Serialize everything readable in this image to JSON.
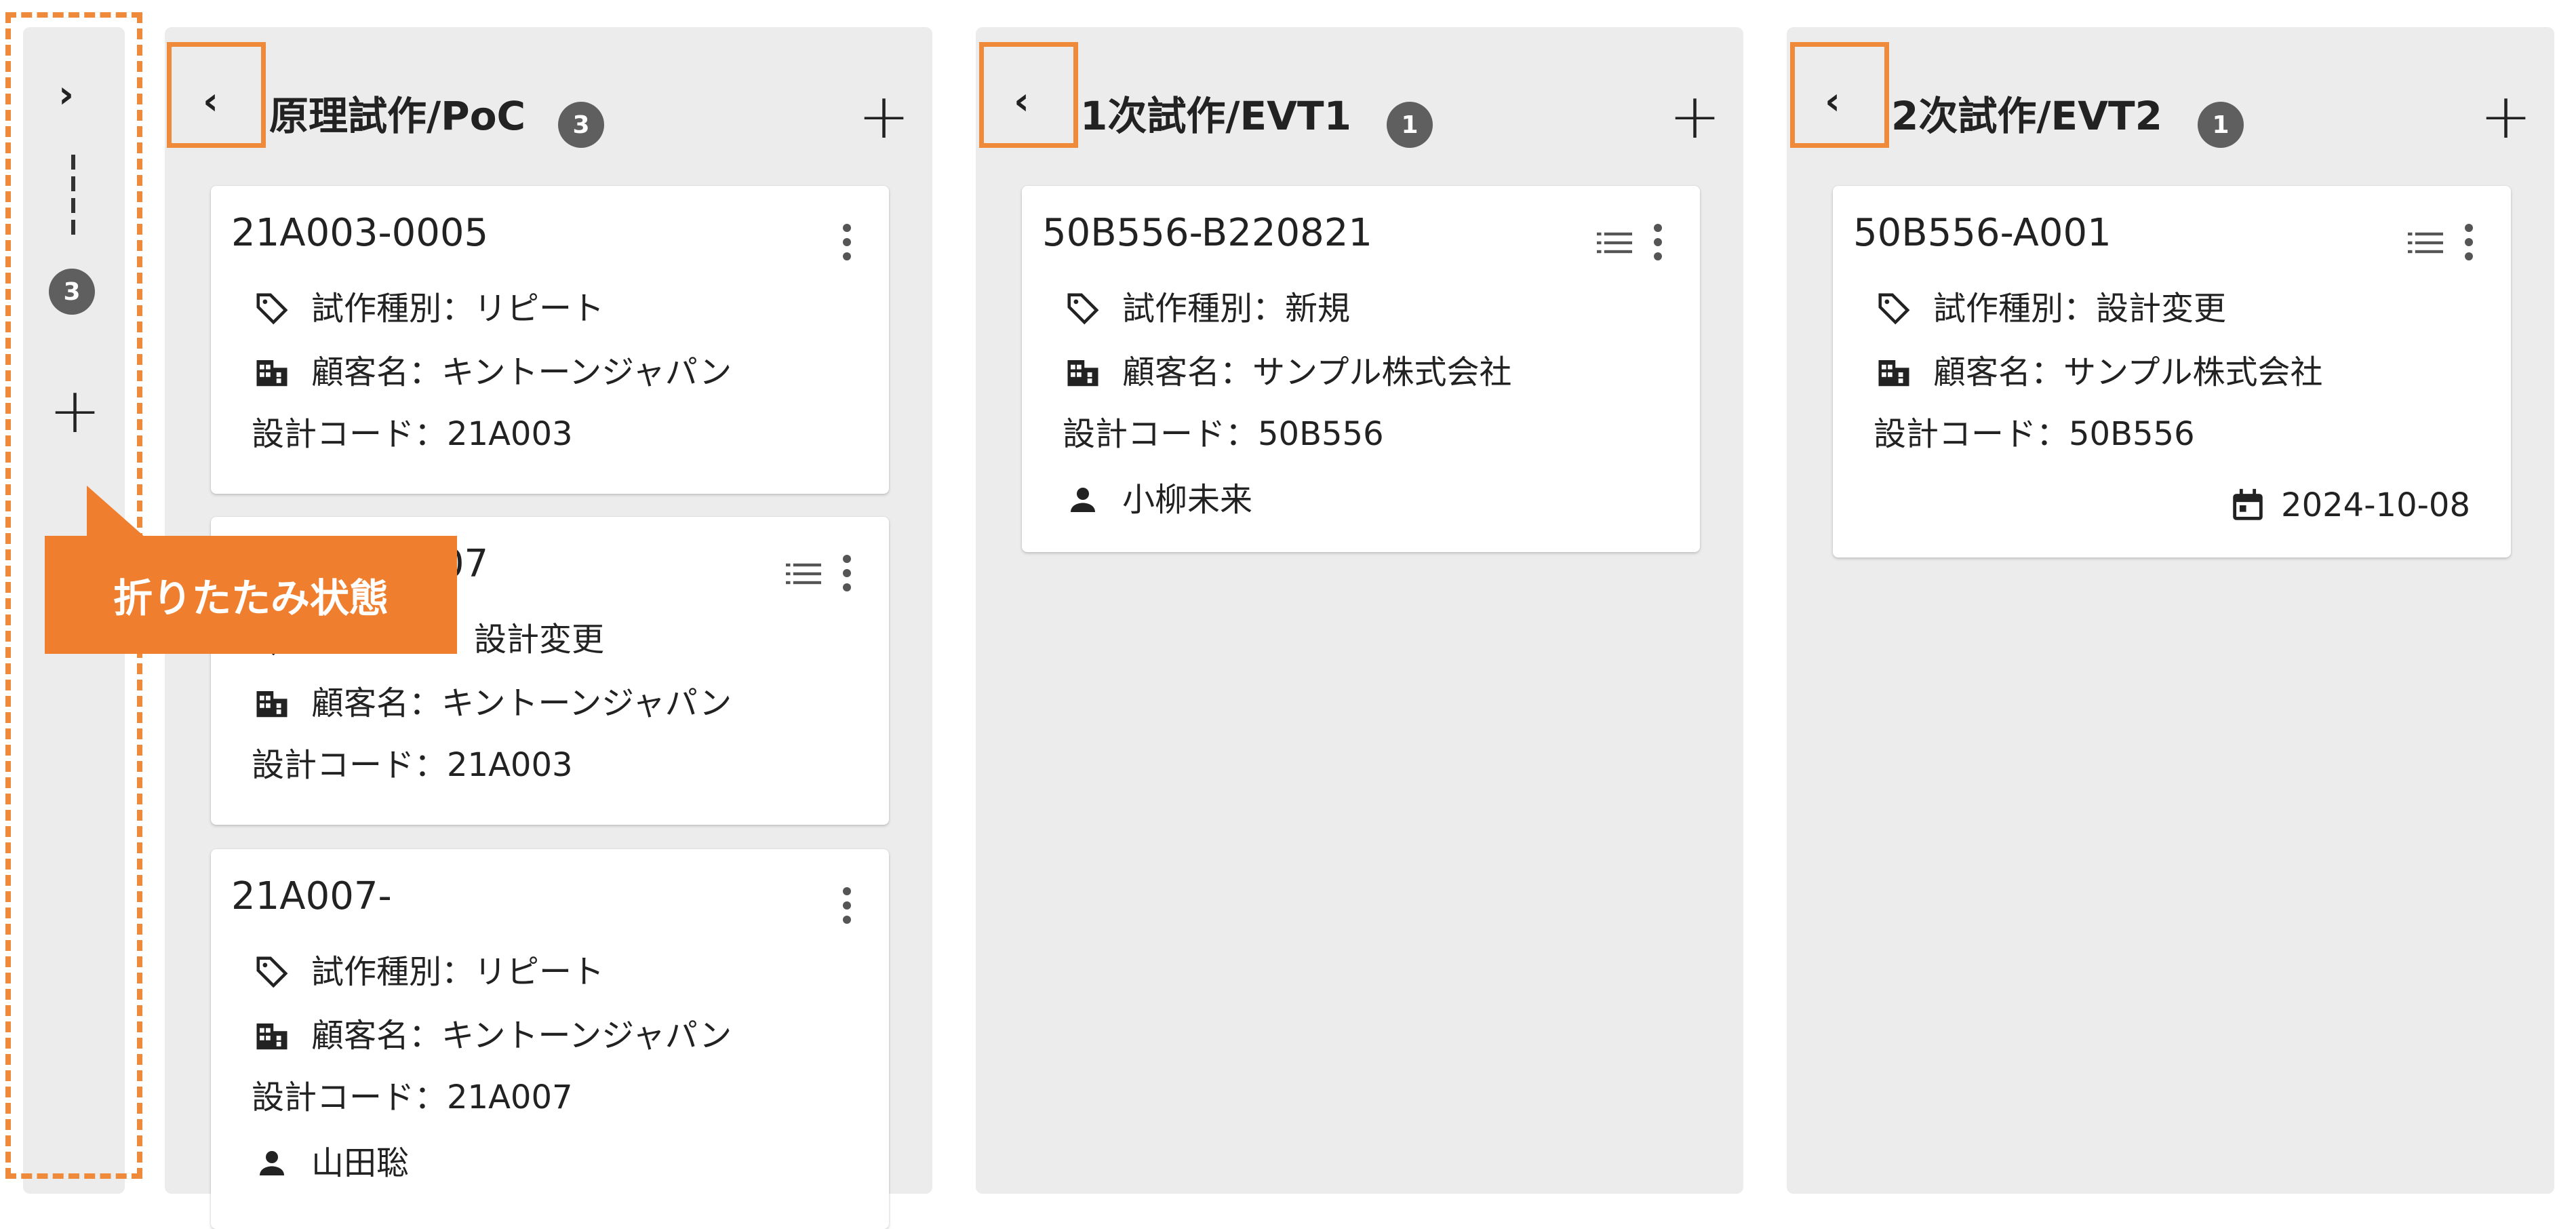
{
  "collapsed_column": {
    "expand_icon": "chevron-right-icon",
    "badge": "3",
    "add_icon": "plus-icon"
  },
  "columns": [
    {
      "title": "原理試作/PoC",
      "badge": "3",
      "collapse_icon": "chevron-left-icon",
      "add_icon": "plus-icon",
      "cards": [
        {
          "id": "21A003-0005",
          "type_label": "試作種別：リピート",
          "customer_label": "顧客名：キントーンジャパン",
          "code_label": "設計コード：21A003"
        },
        {
          "id": "21A003-0007",
          "type_label": "試作種別：設計変更",
          "customer_label": "顧客名：キントーンジャパン",
          "code_label": "設計コード：21A003"
        },
        {
          "id": "21A007-",
          "type_label": "試作種別：リピート",
          "customer_label": "顧客名：キントーンジャパン",
          "code_label": "設計コード：21A007",
          "assignee": "山田聡"
        }
      ]
    },
    {
      "title": "1次試作/EVT1",
      "badge": "1",
      "collapse_icon": "chevron-left-icon",
      "add_icon": "plus-icon",
      "cards": [
        {
          "id": "50B556-B220821",
          "type_label": "試作種別：新規",
          "customer_label": "顧客名：サンプル株式会社",
          "code_label": "設計コード：50B556",
          "assignee": "小柳未来"
        }
      ]
    },
    {
      "title": "2次試作/EVT2",
      "badge": "1",
      "collapse_icon": "chevron-left-icon",
      "add_icon": "plus-icon",
      "cards": [
        {
          "id": "50B556-A001",
          "type_label": "試作種別：設計変更",
          "customer_label": "顧客名：サンプル株式会社",
          "code_label": "設計コード：50B556",
          "date": "2024-10-08"
        }
      ]
    }
  ],
  "annotation": {
    "callout_text": "折りたたみ状態"
  },
  "colors": {
    "accent_orange": "#ef8a3a",
    "column_bg": "#ececec",
    "badge_bg": "#5f5f5f"
  }
}
